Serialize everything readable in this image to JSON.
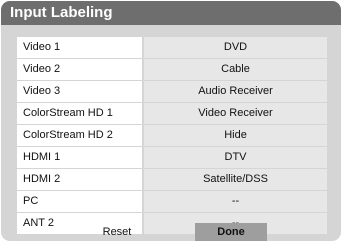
{
  "window": {
    "title": "Input Labeling"
  },
  "rows": [
    {
      "label": "Video 1",
      "value": "DVD"
    },
    {
      "label": "Video 2",
      "value": "Cable"
    },
    {
      "label": "Video 3",
      "value": "Audio Receiver"
    },
    {
      "label": "ColorStream HD 1",
      "value": "Video Receiver"
    },
    {
      "label": "ColorStream HD 2",
      "value": "Hide"
    },
    {
      "label": "HDMI 1",
      "value": "DTV"
    },
    {
      "label": "HDMI 2",
      "value": "Satellite/DSS"
    },
    {
      "label": "PC",
      "value": "--"
    },
    {
      "label": "ANT 2",
      "value": "--"
    }
  ],
  "buttons": {
    "reset": "Reset",
    "done": "Done"
  },
  "colors": {
    "panel": "#d5d5d5",
    "title_bar": "#6e6e6e",
    "label_cell": "#ffffff",
    "value_cell": "#e7e7e7",
    "done_button": "#9e9e9e"
  }
}
